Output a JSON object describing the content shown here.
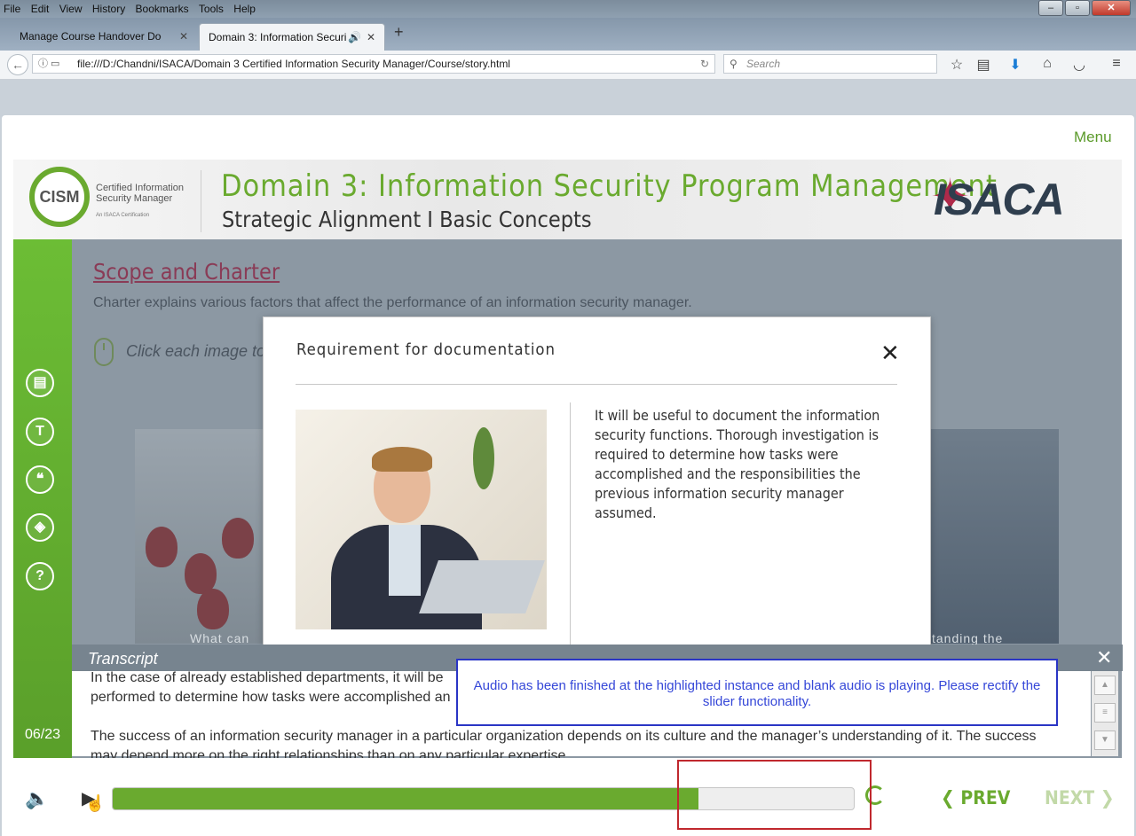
{
  "browser": {
    "menu": [
      "File",
      "Edit",
      "View",
      "History",
      "Bookmarks",
      "Tools",
      "Help"
    ],
    "tabs": [
      {
        "title": "Manage Course Handover Docum"
      },
      {
        "title": "Domain 3: Information Securi"
      }
    ],
    "url": "file:///D:/Chandni/ISACA/Domain 3 Certified Information Security Manager/Course/story.html",
    "search_placeholder": "Search"
  },
  "course": {
    "menu_link": "Menu",
    "logo": {
      "badge": "CISM",
      "text": "Certified Information Security Manager",
      "sub": "An ISACA Certification"
    },
    "title": "Domain 3: Information Security Program Management",
    "subtitle": "Strategic Alignment I Basic Concepts",
    "brand": "ISACA",
    "slide_count": "06/23"
  },
  "slide": {
    "title": "Scope and Charter",
    "description": "Charter explains various factors that affect the performance of an information security manager.",
    "instruction": "Click each image to l",
    "left_caption": "What can",
    "right_caption": "tanding the"
  },
  "modal": {
    "title": "Requirement for documentation",
    "close": "✕",
    "body": "It will be useful to document the information security functions. Thorough investigation is required to determine how tasks were accomplished and the responsibilities the previous information security manager assumed."
  },
  "transcript": {
    "label": "Transcript",
    "close": "✕",
    "p1": "In the case of already established departments, it will be performed to determine how tasks were accomplished an",
    "p2": "The success of an information security manager in a particular organization depends on its culture and the manager’s understanding of it. The success may depend more on the right relationships than on any particular expertise."
  },
  "annotation": {
    "text": "Audio has been finished at the highlighted instance and blank audio is playing. Please rectify the slider functionality."
  },
  "player": {
    "progress": 0.79,
    "prev_label": "PREV",
    "next_label": "NEXT"
  },
  "colors": {
    "accent": "#6aaa2f",
    "title": "#8a3b56",
    "annotation": "#2a35c5",
    "highlight": "#c0282e"
  }
}
